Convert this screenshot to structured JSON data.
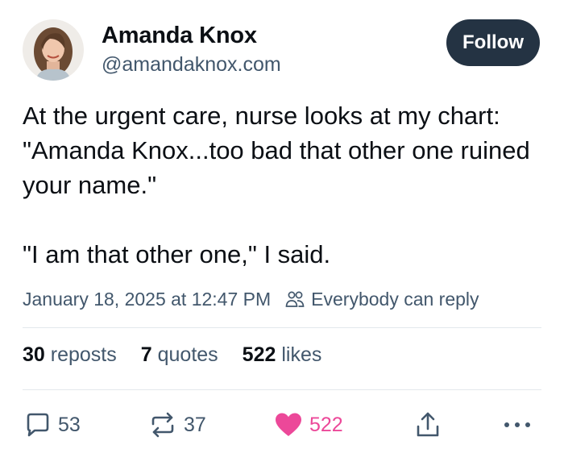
{
  "author": {
    "name": "Amanda Knox",
    "handle": "@amandaknox.com"
  },
  "follow_button": {
    "label": "Follow"
  },
  "post": {
    "paragraphs": [
      "At the urgent care, nurse looks at my chart: \"Amanda Knox...too bad that other one ruined your name.\"",
      "\"I am that other one,\" I said."
    ],
    "timestamp": "January 18, 2025 at 12:47 PM",
    "reply_setting": "Everybody can reply"
  },
  "stats": [
    {
      "count": "30",
      "label": "reposts"
    },
    {
      "count": "7",
      "label": "quotes"
    },
    {
      "count": "522",
      "label": "likes"
    }
  ],
  "actions": {
    "reply_count": "53",
    "repost_count": "37",
    "like_count": "522"
  },
  "icons": {
    "reply": "comment-bubble-icon",
    "repost": "repost-arrows-icon",
    "like": "heart-filled-icon",
    "share": "share-upload-icon",
    "more": "ellipsis-icon",
    "reply_setting": "people-icon"
  },
  "colors": {
    "text": "#0b0f14",
    "muted": "#42576c",
    "follow_bg": "#243343",
    "like": "#ec4899",
    "divider": "#e3e8ec"
  }
}
